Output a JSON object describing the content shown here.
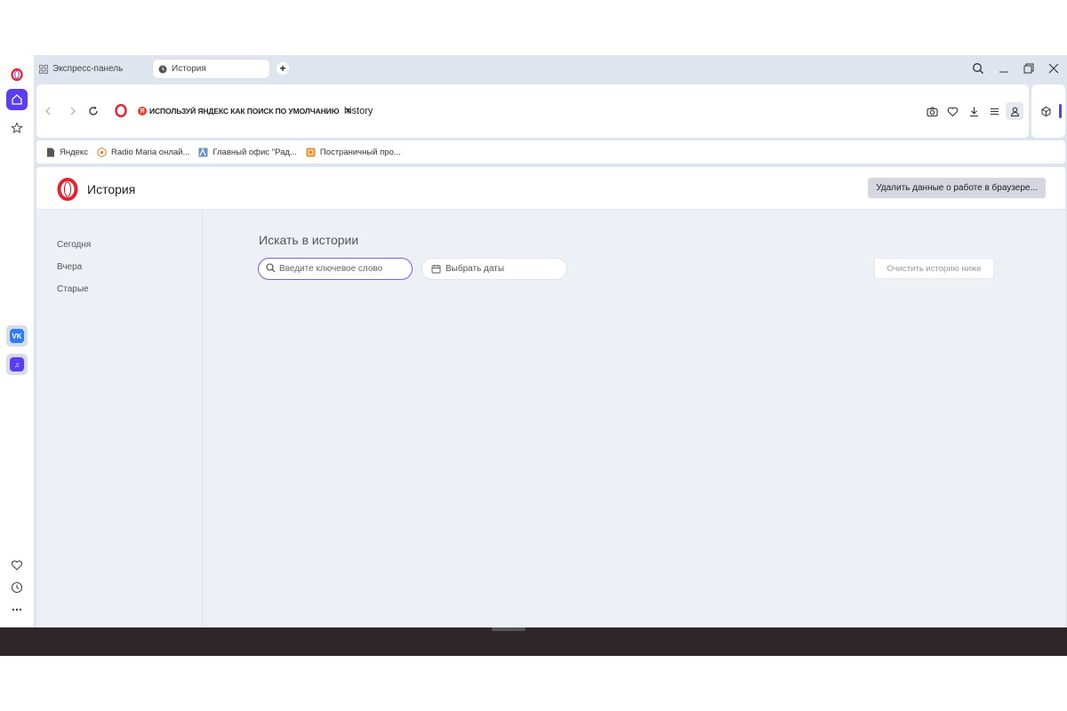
{
  "colors": {
    "accent": "#5b3df5",
    "opera_red": "#e8202b",
    "yandex_red": "#f23d2a"
  },
  "tabs": [
    {
      "label": "Экспресс-панель",
      "icon": "grid-icon"
    },
    {
      "label": "История",
      "icon": "clock-icon",
      "active": true
    }
  ],
  "address_bar": {
    "promo_text": "ИСПОЛЬЗУЙ ЯНДЕКС КАК ПОИСК ПО УМОЛЧАНИЮ",
    "promo_close": "×",
    "url": "history"
  },
  "bookmarks": [
    {
      "label": "Яндекс",
      "icon": "file-icon"
    },
    {
      "label": "Radio Maria онлай...",
      "icon": "radio-maria-icon"
    },
    {
      "label": "Главный офис \"Рад...",
      "icon": "office-icon"
    },
    {
      "label": "Постраничный про...",
      "icon": "reader-icon"
    }
  ],
  "page": {
    "title": "История",
    "clear_data_button": "Удалить данные о работе в браузере...",
    "nav": [
      "Сегодня",
      "Вчера",
      "Старые"
    ],
    "search_heading": "Искать в истории",
    "search_placeholder": "Введите ключевое слово",
    "date_picker_label": "Выбрать даты",
    "clear_history_button": "Очистить историю ниже"
  },
  "sidebar": {
    "top": [
      "opera-logo-icon",
      "home-icon",
      "star-icon"
    ],
    "apps": [
      {
        "name": "vk-icon",
        "text": "VK"
      },
      {
        "name": "player-icon",
        "text": "♫"
      }
    ],
    "bottom": [
      "heart-icon",
      "clock-icon",
      "more-icon"
    ]
  }
}
